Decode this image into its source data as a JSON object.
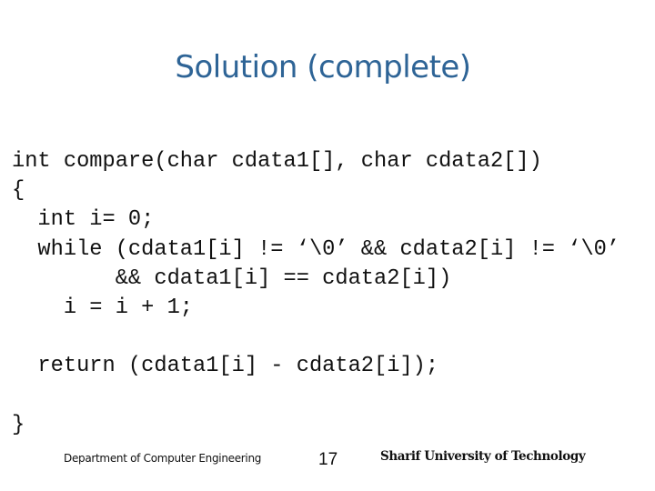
{
  "slide": {
    "title": "Solution (complete)",
    "title_color": "#2e6496",
    "code_lines": [
      "int compare(char cdata1[], char cdata2[])",
      "{",
      "  int i= 0;",
      "  while (cdata1[i] != ‘\\0’ && cdata2[i] != ‘\\0’",
      "        && cdata1[i] == cdata2[i])",
      "    i = i + 1;",
      "",
      "  return (cdata1[i] - cdata2[i]);",
      "",
      "}"
    ],
    "footer": {
      "department": "Department of Computer Engineering",
      "page_number": "17",
      "university": "Sharif University of Technology"
    }
  }
}
